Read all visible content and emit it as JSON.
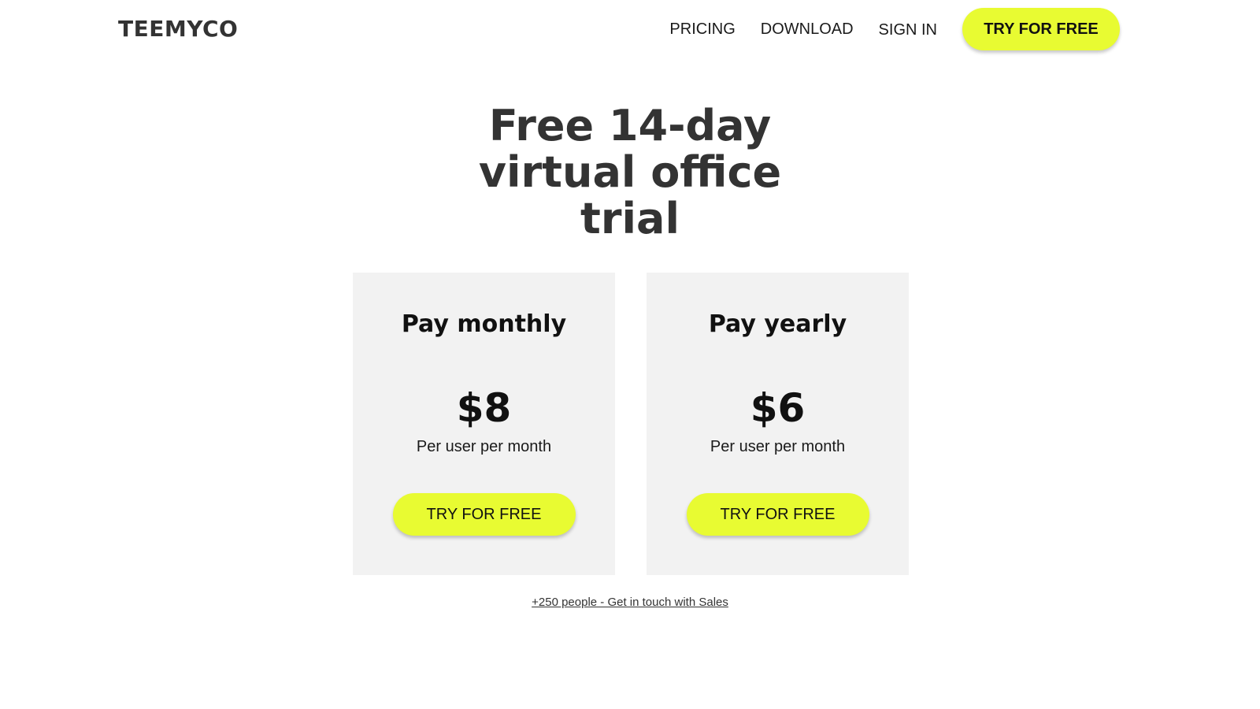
{
  "header": {
    "logo": "TEEMYCO",
    "nav": {
      "pricing": "PRICING",
      "download": "DOWNLOAD",
      "sign_in": "SIGN IN",
      "cta": "TRY FOR FREE"
    }
  },
  "hero": {
    "title_lines": [
      "Free 14-day",
      "virtual office",
      "trial"
    ]
  },
  "plans": [
    {
      "name": "Pay monthly",
      "price": "$8",
      "unit": "Per user per month",
      "cta": "TRY FOR FREE"
    },
    {
      "name": "Pay yearly",
      "price": "$6",
      "unit": "Per user per month",
      "cta": "TRY FOR FREE"
    }
  ],
  "sales_link": "+250 people - Get in touch with Sales",
  "colors": {
    "accent": "#e8fb32",
    "card_bg": "#f2f2f2",
    "heading": "#333333"
  }
}
